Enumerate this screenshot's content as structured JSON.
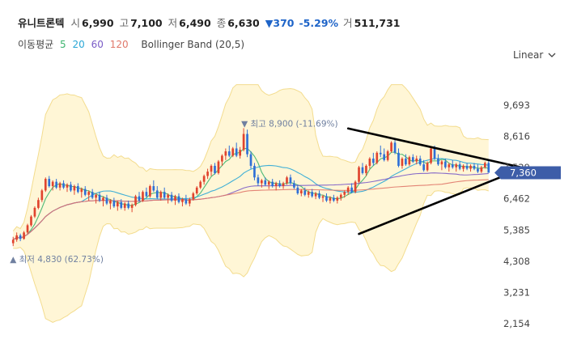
{
  "header": {
    "stock_name": "유니트론텍",
    "open_label": "시",
    "open": "6,990",
    "high_label": "고",
    "high": "7,100",
    "low_label": "저",
    "low": "6,490",
    "close_label": "종",
    "close": "6,630",
    "change": "▼370",
    "change_pct": "-5.29%",
    "volume_label": "거",
    "volume": "511,731"
  },
  "ma_legend": {
    "label": "이동평균",
    "periods": [
      {
        "value": "5",
        "color": "#3cb46e"
      },
      {
        "value": "20",
        "color": "#2aa7d6"
      },
      {
        "value": "60",
        "color": "#7a5cc7"
      },
      {
        "value": "120",
        "color": "#e0786a"
      }
    ],
    "bollinger": "Bollinger Band (20,5)"
  },
  "scale_toggle": {
    "label": "Linear"
  },
  "current_price_badge": "7,360",
  "chart_data": {
    "type": "candlestick",
    "y_ticks": [
      "9,693",
      "8,616",
      "7,539",
      "6,462",
      "5,385",
      "4,308",
      "3,231",
      "2,154"
    ],
    "ylim": [
      1900,
      10500
    ],
    "annotations": {
      "high_label": "최고",
      "high_value": "8,900",
      "high_pct": "(-11.69%)",
      "low_label": "최저",
      "low_value": "4,830",
      "low_pct": "(62.73%)"
    },
    "candles": [
      [
        4930,
        5150,
        4830,
        5050
      ],
      [
        5050,
        5300,
        4980,
        5200
      ],
      [
        5200,
        5260,
        5000,
        5080
      ],
      [
        5080,
        5350,
        5050,
        5300
      ],
      [
        5300,
        5600,
        5250,
        5550
      ],
      [
        5550,
        5900,
        5500,
        5850
      ],
      [
        5850,
        6200,
        5800,
        6150
      ],
      [
        6150,
        6500,
        6100,
        6420
      ],
      [
        6420,
        6800,
        6350,
        6750
      ],
      [
        6750,
        7200,
        6700,
        7150
      ],
      [
        7150,
        7250,
        6850,
        6900
      ],
      [
        6900,
        7100,
        6750,
        7050
      ],
      [
        7050,
        7150,
        6800,
        6850
      ],
      [
        6850,
        7050,
        6750,
        7000
      ],
      [
        7000,
        7100,
        6800,
        6850
      ],
      [
        6850,
        7000,
        6700,
        6950
      ],
      [
        6950,
        7050,
        6700,
        6750
      ],
      [
        6750,
        6950,
        6600,
        6900
      ],
      [
        6900,
        7000,
        6650,
        6700
      ],
      [
        6700,
        6850,
        6500,
        6800
      ],
      [
        6800,
        6900,
        6550,
        6600
      ],
      [
        6600,
        6750,
        6400,
        6700
      ],
      [
        6700,
        6800,
        6450,
        6500
      ],
      [
        6500,
        6650,
        6300,
        6600
      ],
      [
        6600,
        6700,
        6350,
        6400
      ],
      [
        6400,
        6550,
        6200,
        6500
      ],
      [
        6500,
        6600,
        6250,
        6300
      ],
      [
        6300,
        6450,
        6100,
        6400
      ],
      [
        6400,
        6500,
        6150,
        6200
      ],
      [
        6200,
        6400,
        6050,
        6350
      ],
      [
        6350,
        6450,
        6100,
        6150
      ],
      [
        6150,
        6350,
        6050,
        6300
      ],
      [
        6300,
        6400,
        6100,
        6150
      ],
      [
        6150,
        6300,
        6000,
        6250
      ],
      [
        6250,
        6600,
        6200,
        6550
      ],
      [
        6550,
        6700,
        6350,
        6400
      ],
      [
        6400,
        6750,
        6350,
        6700
      ],
      [
        6700,
        6850,
        6500,
        6550
      ],
      [
        6550,
        6950,
        6500,
        6900
      ],
      [
        6900,
        7100,
        6700,
        6750
      ],
      [
        6750,
        6900,
        6450,
        6500
      ],
      [
        6500,
        6750,
        6400,
        6700
      ],
      [
        6700,
        6850,
        6450,
        6500
      ],
      [
        6500,
        6650,
        6300,
        6600
      ],
      [
        6600,
        6700,
        6350,
        6400
      ],
      [
        6400,
        6600,
        6250,
        6550
      ],
      [
        6550,
        6650,
        6300,
        6350
      ],
      [
        6350,
        6500,
        6200,
        6450
      ],
      [
        6450,
        6600,
        6250,
        6300
      ],
      [
        6300,
        6500,
        6200,
        6450
      ],
      [
        6450,
        6700,
        6400,
        6650
      ],
      [
        6650,
        6900,
        6600,
        6850
      ],
      [
        6850,
        7100,
        6800,
        7050
      ],
      [
        7050,
        7300,
        6950,
        7250
      ],
      [
        7250,
        7500,
        7150,
        7400
      ],
      [
        7400,
        7650,
        7250,
        7600
      ],
      [
        7600,
        7700,
        7300,
        7350
      ],
      [
        7350,
        7800,
        7300,
        7750
      ],
      [
        7750,
        8000,
        7600,
        7950
      ],
      [
        7950,
        8200,
        7800,
        8100
      ],
      [
        8100,
        8300,
        7900,
        7950
      ],
      [
        7950,
        8250,
        7900,
        8200
      ],
      [
        8200,
        8400,
        7900,
        7950
      ],
      [
        7950,
        8250,
        7850,
        8150
      ],
      [
        8150,
        8900,
        8100,
        8700
      ],
      [
        8700,
        8850,
        7900,
        8000
      ],
      [
        8000,
        8100,
        7500,
        7600
      ],
      [
        7600,
        7700,
        7100,
        7200
      ],
      [
        7200,
        7300,
        6900,
        7000
      ],
      [
        7000,
        7150,
        6850,
        7100
      ],
      [
        7100,
        7200,
        6900,
        6950
      ],
      [
        6950,
        7100,
        6800,
        7050
      ],
      [
        7050,
        7150,
        6850,
        6900
      ],
      [
        6900,
        7050,
        6750,
        7000
      ],
      [
        7000,
        7100,
        6850,
        6900
      ],
      [
        6900,
        7050,
        6800,
        7000
      ],
      [
        7000,
        7250,
        6950,
        7200
      ],
      [
        7200,
        7300,
        6950,
        7000
      ],
      [
        7000,
        7100,
        6800,
        6850
      ],
      [
        6850,
        6950,
        6600,
        6650
      ],
      [
        6650,
        6800,
        6550,
        6750
      ],
      [
        6750,
        6850,
        6550,
        6600
      ],
      [
        6600,
        6750,
        6500,
        6700
      ],
      [
        6700,
        6800,
        6500,
        6550
      ],
      [
        6550,
        6700,
        6450,
        6650
      ],
      [
        6650,
        6750,
        6450,
        6500
      ],
      [
        6500,
        6600,
        6350,
        6550
      ],
      [
        6550,
        6650,
        6350,
        6400
      ],
      [
        6400,
        6550,
        6300,
        6500
      ],
      [
        6500,
        6600,
        6350,
        6400
      ],
      [
        6400,
        6550,
        6300,
        6500
      ],
      [
        6500,
        6650,
        6400,
        6600
      ],
      [
        6600,
        6750,
        6500,
        6700
      ],
      [
        6700,
        6900,
        6600,
        6850
      ],
      [
        6850,
        7000,
        6650,
        6700
      ],
      [
        6700,
        7100,
        6650,
        7050
      ],
      [
        7050,
        7600,
        7000,
        7550
      ],
      [
        7550,
        7700,
        7300,
        7350
      ],
      [
        7350,
        7650,
        7250,
        7600
      ],
      [
        7600,
        7900,
        7500,
        7850
      ],
      [
        7850,
        8050,
        7600,
        7700
      ],
      [
        7700,
        8100,
        7650,
        8050
      ],
      [
        8050,
        8300,
        7900,
        8000
      ],
      [
        8000,
        8200,
        7750,
        7800
      ],
      [
        7800,
        8150,
        7750,
        8100
      ],
      [
        8100,
        8450,
        8050,
        8400
      ],
      [
        8400,
        8550,
        8000,
        8050
      ],
      [
        8050,
        8200,
        7550,
        7600
      ],
      [
        7600,
        7900,
        7500,
        7850
      ],
      [
        7850,
        8000,
        7600,
        7650
      ],
      [
        7650,
        7950,
        7600,
        7900
      ],
      [
        7900,
        8000,
        7700,
        7750
      ],
      [
        7750,
        7950,
        7650,
        7850
      ],
      [
        7850,
        7950,
        7600,
        7650
      ],
      [
        7650,
        7800,
        7400,
        7450
      ],
      [
        7450,
        7750,
        7400,
        7700
      ],
      [
        7700,
        8250,
        7650,
        8200
      ],
      [
        8200,
        8300,
        7800,
        7850
      ],
      [
        7850,
        8000,
        7600,
        7650
      ],
      [
        7650,
        7800,
        7450,
        7750
      ],
      [
        7750,
        7850,
        7500,
        7550
      ],
      [
        7550,
        7700,
        7400,
        7650
      ],
      [
        7650,
        7800,
        7500,
        7550
      ],
      [
        7550,
        7700,
        7400,
        7650
      ],
      [
        7650,
        7750,
        7450,
        7500
      ],
      [
        7500,
        7650,
        7400,
        7600
      ],
      [
        7600,
        7700,
        7450,
        7500
      ],
      [
        7500,
        7650,
        7400,
        7600
      ],
      [
        7600,
        7700,
        7450,
        7500
      ],
      [
        7500,
        7650,
        7350,
        7400
      ],
      [
        7400,
        7600,
        7350,
        7550
      ],
      [
        7550,
        7750,
        7500,
        7700
      ],
      [
        7700,
        7800,
        7400,
        7360
      ]
    ],
    "trendlines": [
      {
        "from": [
          96,
          5250
        ],
        "to": [
          142,
          7540
        ]
      },
      {
        "from": [
          93,
          8890
        ],
        "to": [
          142,
          7520
        ]
      }
    ]
  }
}
